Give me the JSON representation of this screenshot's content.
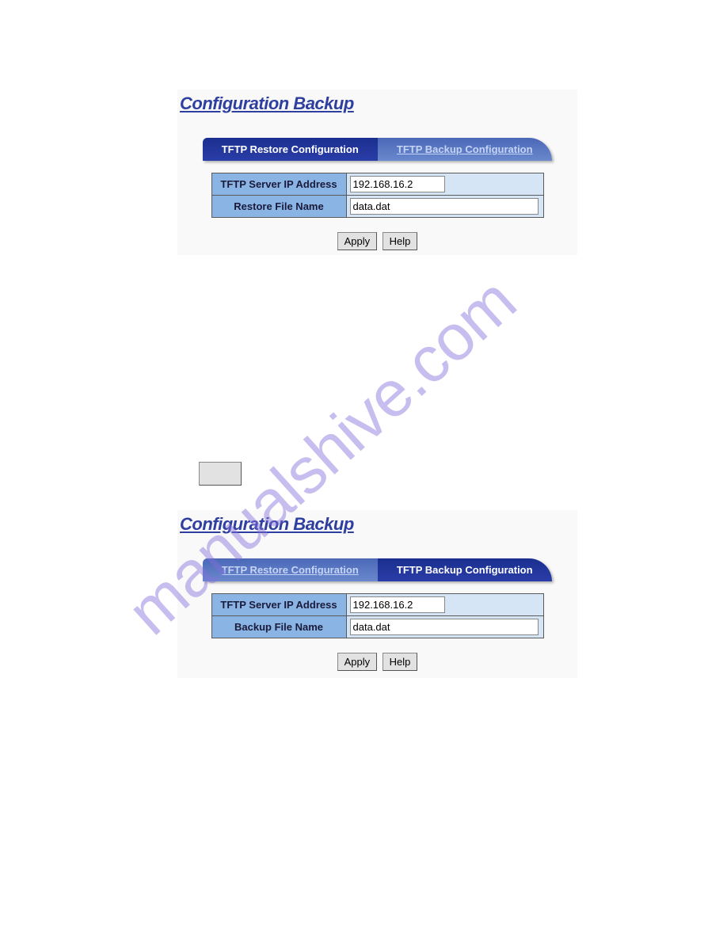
{
  "watermark": "manualshive.com",
  "panelRestore": {
    "title": "Configuration Backup",
    "tabs": {
      "restore": "TFTP Restore Configuration",
      "backup": "TFTP Backup Configuration"
    },
    "fields": {
      "serverLabel": "TFTP Server IP Address",
      "serverValue": "192.168.16.2",
      "fileLabel": "Restore File Name",
      "fileValue": "data.dat"
    },
    "buttons": {
      "apply": "Apply",
      "help": "Help"
    }
  },
  "panelBackup": {
    "title": "Configuration Backup",
    "tabs": {
      "restore": "TFTP Restore Configuration",
      "backup": "TFTP Backup Configuration"
    },
    "fields": {
      "serverLabel": "TFTP Server IP Address",
      "serverValue": "192.168.16.2",
      "fileLabel": "Backup File Name",
      "fileValue": "data.dat"
    },
    "buttons": {
      "apply": "Apply",
      "help": "Help"
    }
  }
}
